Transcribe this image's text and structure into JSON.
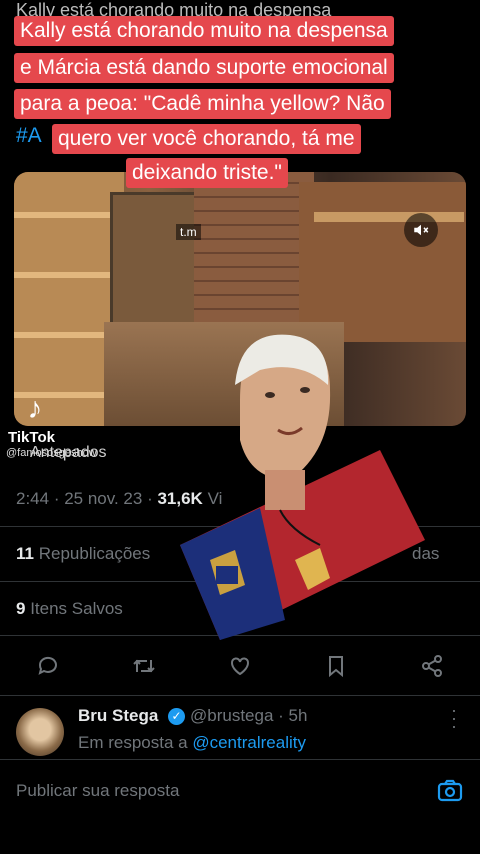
{
  "caption": {
    "faded_top": "Kally está chorando muito na despensa",
    "line1": "Kally está chorando muito na despensa",
    "line2": "e Márcia está dando suporte emocional",
    "line3": "para a peoa: \"Cadê minha yellow? Não",
    "line4": "quero ver você chorando, tá me",
    "line5": "deixando triste.\"",
    "hashtag": "#A"
  },
  "video": {
    "overlay_text": "t.m",
    "mute_icon": "speaker-mute-icon"
  },
  "tiktok": {
    "brand": "TikTok",
    "username": "@famososgeshow",
    "repost_label": "Antepados"
  },
  "tweet": {
    "time": "2:44",
    "date": "25 nov. 23",
    "views_count": "31,6K",
    "views_label": "Vi",
    "reposts_count": "11",
    "reposts_label": "Republicações",
    "likes_label_partial": "das",
    "saves_count": "9",
    "saves_label": "Itens Salvos"
  },
  "actions": [
    "reply-icon",
    "repost-icon",
    "like-icon",
    "bookmark-icon",
    "share-icon"
  ],
  "reply": {
    "name": "Bru Stega",
    "handle": "@brustega",
    "time": "· 5h",
    "in_reply_prefix": "Em resposta a",
    "in_reply_to": "@centralreality"
  },
  "composer": {
    "placeholder": "Publicar sua resposta"
  },
  "colors": {
    "caption_bg": "#e5484d",
    "accent": "#1d9bf0",
    "muted": "#71767b",
    "background": "#000000"
  }
}
